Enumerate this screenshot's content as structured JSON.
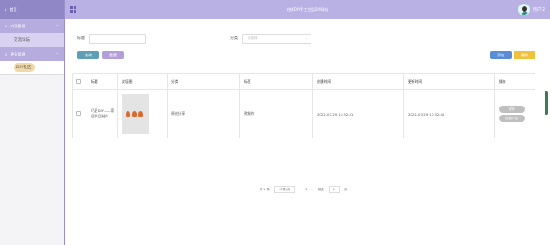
{
  "sidebar": {
    "logo": "首页",
    "groups": [
      {
        "label": "内容管理",
        "items": [
          {
            "label": "交流论坛"
          }
        ]
      },
      {
        "label": "更多管理",
        "items": [
          {
            "label": "DIY社区"
          }
        ]
      }
    ]
  },
  "topbar": {
    "title": "在线DIY手工艺品DIY网站",
    "user": "用户2"
  },
  "search": {
    "title_label": "标题",
    "title_placeholder": "",
    "category_label": "分类",
    "category_placeholder": "请选择",
    "search_button": "查询",
    "reset_button": "重置",
    "add_button": "添加",
    "delete_button": "删除"
  },
  "table": {
    "headers": [
      "",
      "标题",
      "封面图",
      "分类",
      "标签",
      "创建时间",
      "更新时间",
      "操作"
    ],
    "rows": [
      {
        "title": "巧匠DIY——家居饰品制作",
        "category": "原创分享",
        "tag": "熬制作",
        "created": "2022-03-29 11:32:41",
        "updated": "2022-03-29 11:32:41",
        "actions": [
          "详情",
          "查看评论"
        ]
      }
    ]
  },
  "pager": {
    "total": "共 1 条",
    "page_size": "10条/页",
    "prev": "‹",
    "page": "1",
    "next": "›",
    "goto_label": "前往",
    "goto_value": "1",
    "page_suffix": "页"
  },
  "colors": {
    "sidebar_header": "#9088c6",
    "topbar": "#b9b0e3",
    "search_button": "#5f9fb6",
    "reset_button": "#b39ddb",
    "add_button": "#5b8dd6",
    "delete_button": "#f0c23b"
  }
}
